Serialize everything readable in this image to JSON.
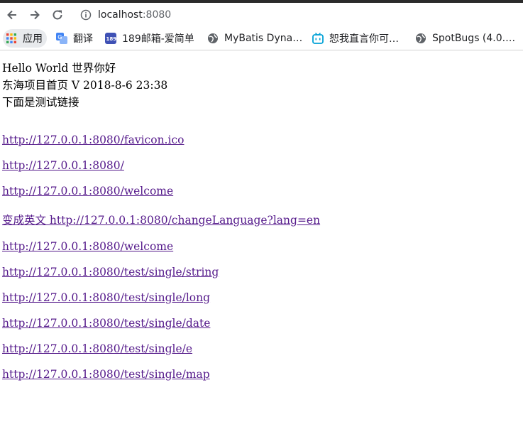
{
  "browser": {
    "url_host": "localhost",
    "url_port": ":8080",
    "nav_icons": [
      "back-arrow-icon",
      "forward-arrow-icon",
      "reload-icon",
      "info-icon"
    ]
  },
  "bookmarks": [
    {
      "label": "应用",
      "icon": "apps-grid-icon"
    },
    {
      "label": "翻译",
      "icon": "translate-icon"
    },
    {
      "label": "189邮箱-爱简单",
      "icon": "mail-189-icon"
    },
    {
      "label": "MyBatis Dyna…",
      "icon": "globe-icon"
    },
    {
      "label": "恕我直言你可…",
      "icon": "tv-icon"
    },
    {
      "label": "SpotBugs (4.0.…",
      "icon": "globe-icon"
    }
  ],
  "page": {
    "greeting": "Hello World 世界你好",
    "version_line": "东海项目首页 V 2018-8-6 23:38",
    "intro": "下面是测试链接"
  },
  "links": [
    {
      "text": "http://127.0.0.1:8080/favicon.ico"
    },
    {
      "text": "http://127.0.0.1:8080/"
    },
    {
      "text": "http://127.0.0.1:8080/welcome"
    },
    {
      "text": "变成英文 http://127.0.0.1:8080/changeLanguage?lang=en"
    },
    {
      "text": "http://127.0.0.1:8080/welcome"
    },
    {
      "text": "http://127.0.0.1:8080/test/single/string"
    },
    {
      "text": "http://127.0.0.1:8080/test/single/long"
    },
    {
      "text": "http://127.0.0.1:8080/test/single/date"
    },
    {
      "text": "http://127.0.0.1:8080/test/single/e"
    },
    {
      "text": "http://127.0.0.1:8080/test/single/map"
    }
  ],
  "colors": {
    "link_visited": "#551a8b",
    "topbar": "#2b2b2b",
    "apps_chip_bg": "#e8eaed"
  }
}
